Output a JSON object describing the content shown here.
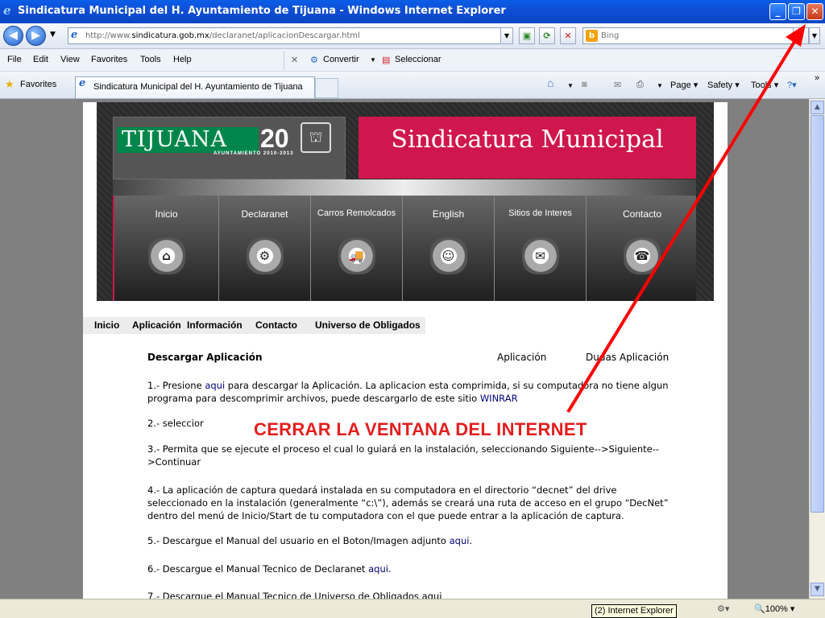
{
  "window": {
    "title": "Sindicatura Municipal del H. Ayuntamiento de Tijuana - Windows Internet Explorer",
    "minimize_label": "_",
    "restore_label": "❐",
    "close_label": "✕"
  },
  "address": {
    "url_prefix": "http://www.",
    "url_domain": "sindicatura.gob.mx",
    "url_path": "/declaranet/aplicacionDescargar.html",
    "search_placeholder": "Bing"
  },
  "menu": [
    "File",
    "Edit",
    "View",
    "Favorites",
    "Tools",
    "Help"
  ],
  "toolbar": {
    "convertir": "Convertir",
    "seleccionar": "Seleccionar",
    "favorites": "Favorites",
    "tab_title": "Sindicatura Municipal del H. Ayuntamiento de Tijuana",
    "page": "Page",
    "safety": "Safety",
    "tools": "Tools",
    "more": "»"
  },
  "banner": {
    "logo_text": "TIJUANA",
    "logo_number": "20",
    "logo_sub": "AYUNTAMIENTO 2010-2013",
    "title": "Sindicatura Municipal",
    "nav": [
      {
        "label": "Inicio",
        "icon": "home-icon",
        "glyph": "⌂"
      },
      {
        "label": "Declaranet",
        "icon": "gear-icon",
        "glyph": "⚙"
      },
      {
        "label": "Carros Remolcados",
        "icon": "tow-truck-icon",
        "glyph": "🚚"
      },
      {
        "label": "English",
        "icon": "person-icon",
        "glyph": "☺"
      },
      {
        "label": "Sitios de Interes",
        "icon": "mail-icon",
        "glyph": "✉"
      },
      {
        "label": "Contacto",
        "icon": "phone-icon",
        "glyph": "☎"
      }
    ]
  },
  "site_menu": [
    "Inicio",
    "Aplicación",
    "Información",
    "Contacto",
    "Universo de Obligados"
  ],
  "content": {
    "title": "Descargar Aplicación",
    "header_app": "Aplicación",
    "header_dudas": "Dudas Aplicación",
    "step1_a": "1.- Presione ",
    "step1_link": "aqui",
    "step1_b": " para descargar la Aplicación. La aplicacion esta comprimida, si su computadora no tiene algun",
    "step1_c": "programa para descomprimir archivos, puede descargarlo de este sitio ",
    "step1_winrar": "WINRAR",
    "step2": "2.- seleccior",
    "step3_a": "3.- Permita que se ejecute el proceso el cual lo guiará en la instalación, seleccionando Siguiente-->Siguiente--",
    "step3_b": ">Continuar",
    "step4_a": "4.- La aplicación de captura quedará instalada en su computadora en el directorio “decnet” del drive",
    "step4_b": "seleccionado en la instalación (generalmente “c:\\”), además se creará una ruta de acceso en el grupo “DecNet”",
    "step4_c": "dentro del menú de Inicio/Start de tu computadora con el que puede entrar a la aplicación de captura.",
    "step5_a": "5.- Descargue el Manual del usuario en el Boton/Imagen adjunto ",
    "step5_link": "aqui",
    "step5_b": ".",
    "step6_a": "6.- Descargue el Manual Tecnico de Declaranet ",
    "step6_link": "aqui",
    "step6_b": ".",
    "step7": "7.- Descargue el Manual Tecnico de Universo de Obligados aqui"
  },
  "annotation": {
    "text": "CERRAR LA VENTANA DEL INTERNET",
    "color": "#e41e1e"
  },
  "status": {
    "tooltip": "(2) Internet Explorer",
    "zoom": "100%"
  }
}
